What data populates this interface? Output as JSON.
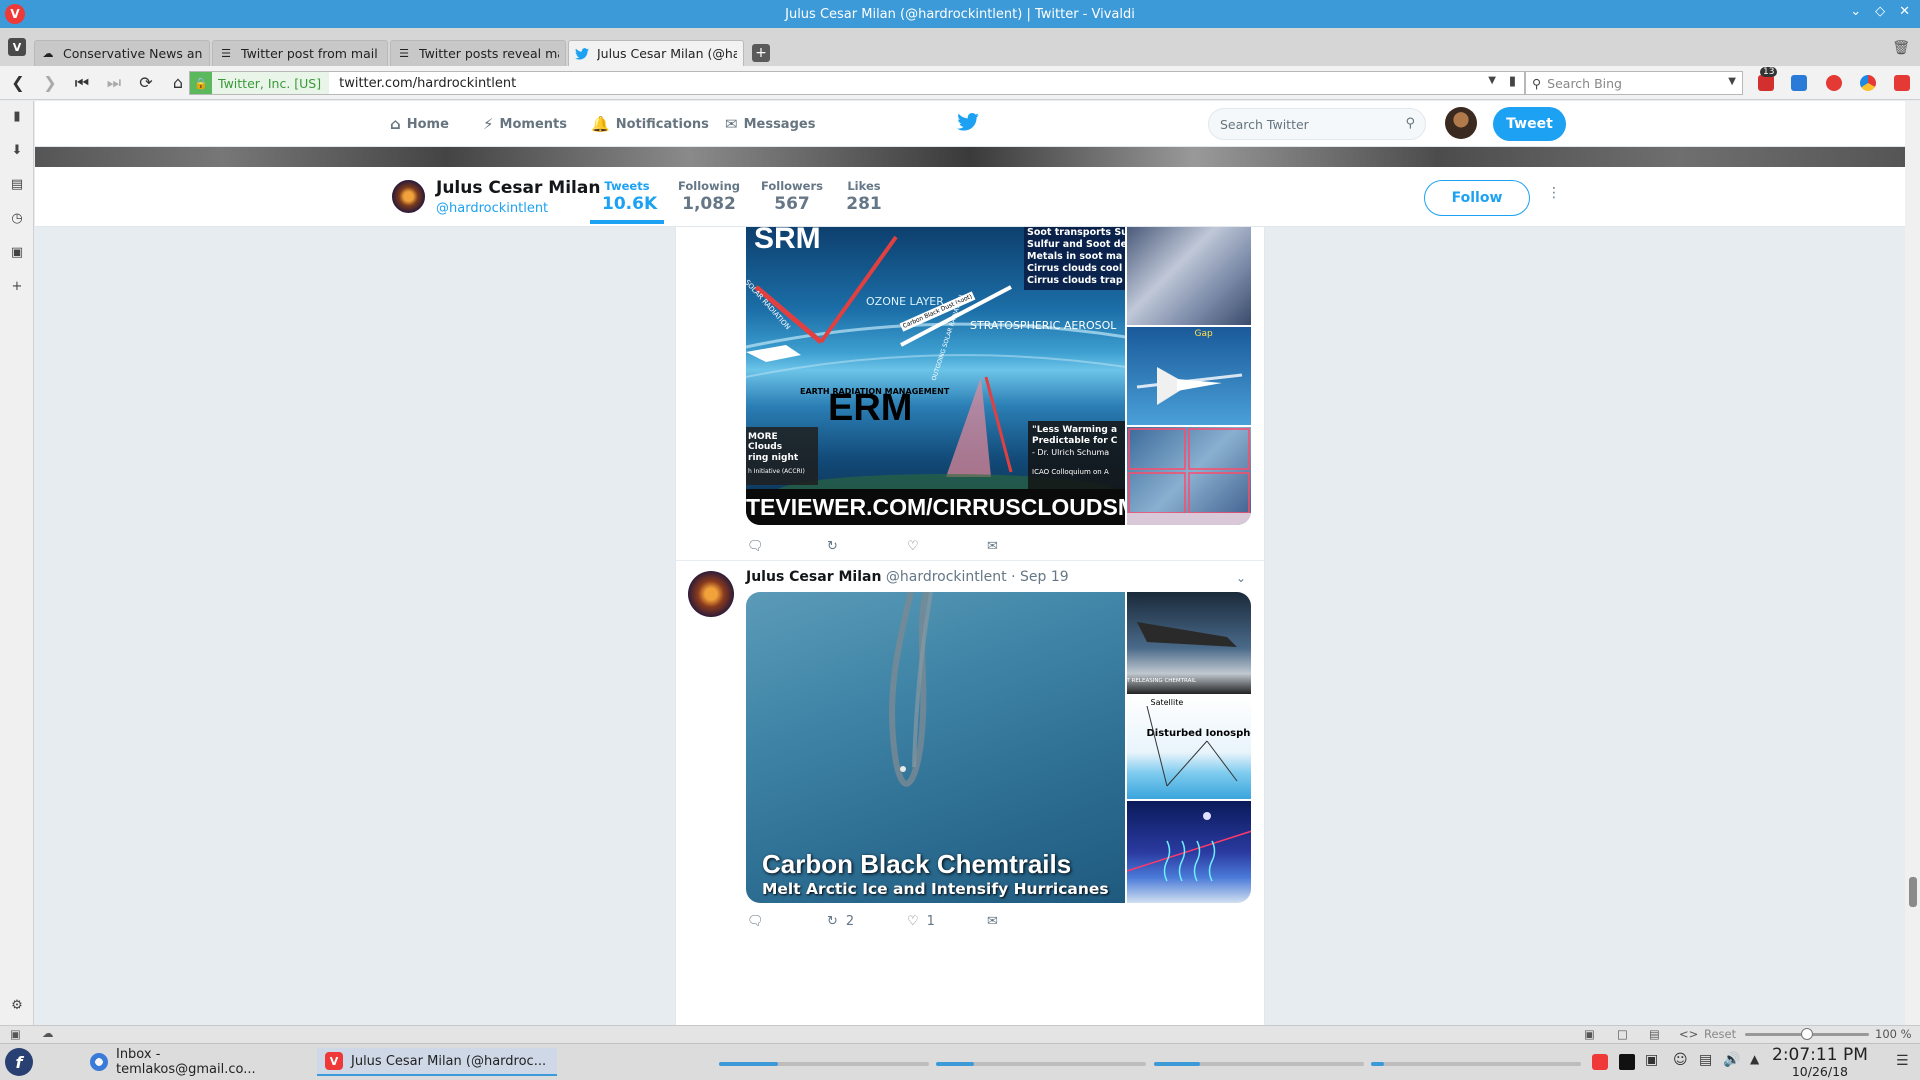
{
  "window": {
    "title": "Julus Cesar Milan (@hardrockintlent) | Twitter - Vivaldi"
  },
  "tabs": [
    {
      "label": "Conservative News and V",
      "icon": "conservative-icon"
    },
    {
      "label": "Twitter post from mail bo",
      "icon": "page-icon"
    },
    {
      "label": "Twitter posts reveal mail",
      "icon": "page-icon"
    },
    {
      "label": "Julus Cesar Milan (@harc",
      "icon": "twitter-bird-icon",
      "active": true
    }
  ],
  "addressbar": {
    "cert_label": "Twitter, Inc. [US]",
    "url": "twitter.com/hardrockintlent",
    "search_placeholder": "Search Bing",
    "mail_badge": "13"
  },
  "twitter_nav": {
    "home": "Home",
    "moments": "Moments",
    "notifications": "Notifications",
    "messages": "Messages",
    "search_placeholder": "Search Twitter",
    "tweet_button": "Tweet"
  },
  "profile": {
    "name": "Julus Cesar Milan",
    "handle": "@hardrockintlent",
    "stats": [
      {
        "label": "Tweets",
        "value": "10.6K",
        "active": true
      },
      {
        "label": "Following",
        "value": "1,082"
      },
      {
        "label": "Followers",
        "value": "567"
      },
      {
        "label": "Likes",
        "value": "281"
      }
    ],
    "follow_label": "Follow"
  },
  "tweet1": {
    "media_texts": {
      "srm": "SRM",
      "ozone": "OZONE LAYER",
      "solar": "SOLAR RADIATION",
      "carbon": "Carbon Black Dust (soot)",
      "strato": "STRATOSPHERIC AEROSOL",
      "erm_small": "EARTH RADIATION MANAGEMENT",
      "erm": "ERM",
      "outgoing": "OUTGOING SOLAR RADIATION",
      "more1": "MORE",
      "more2": "Clouds",
      "more3": "ring night",
      "more4": "h Initiative (ACCRI)",
      "quote1": "\"Less Warming a",
      "quote2": "Predictable for C",
      "quote3": "- Dr. Ulrich Schuma",
      "quote4": "ICAO Colloquium on A",
      "soot1": "Soot transports Su",
      "soot2": "Sulfur and Soot de",
      "soot3": "Metals in soot ma",
      "soot4": "Cirrus clouds cool",
      "soot5": "Cirrus clouds trap",
      "gap": "Gap",
      "url": "TEVIEWER.COM/CIRRUSCLOUDSM"
    },
    "retweets": "",
    "likes": ""
  },
  "tweet2": {
    "name": "Julus Cesar Milan",
    "handle": "@hardrockintlent",
    "sep": "·",
    "date": "Sep 19",
    "media_texts": {
      "headline": "Carbon Black Chemtrails",
      "subline": "Melt Arctic Ice and Intensify Hurricanes",
      "side1": "T RELEASING CHEMTRAIL",
      "side2a": "Satellite",
      "side2b": "Disturbed Ionosphere"
    },
    "retweets": "2",
    "likes": "1"
  },
  "statusbar": {
    "reset": "Reset",
    "zoom_label": "100 %",
    "zoom_value": 100
  },
  "taskbar": {
    "tasks": [
      {
        "label": "Inbox - temlakos@gmail.co...",
        "icon": "thunderbird-icon"
      },
      {
        "label": "Julus Cesar Milan (@hardroc...",
        "icon": "vivaldi-icon",
        "active": true
      }
    ],
    "progress": [
      0.28,
      0.18,
      0.22,
      0.06
    ],
    "time": "2:07:11 PM",
    "date": "10/26/18"
  },
  "colors": {
    "titlebar": "#3c9ad8",
    "twitter_blue": "#1da1f2",
    "vivaldi_red": "#ef3939"
  }
}
